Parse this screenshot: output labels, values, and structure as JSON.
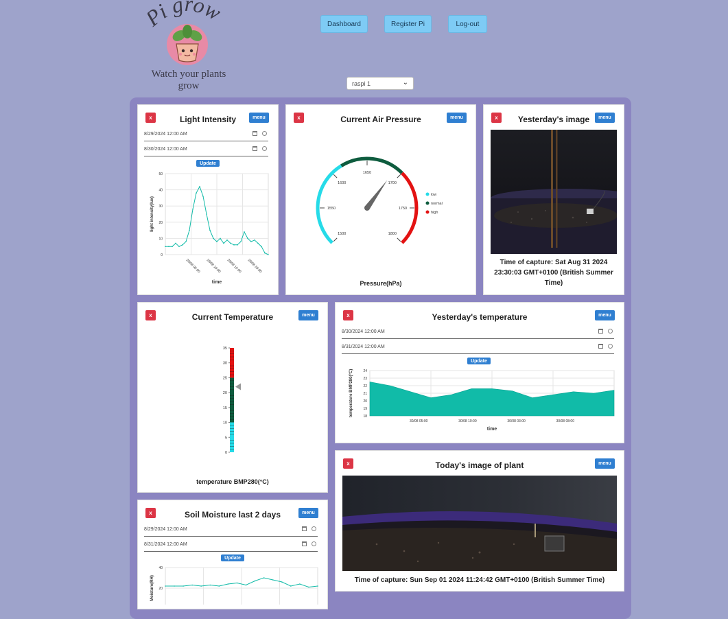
{
  "header": {
    "logo_text": "Pi grow",
    "tagline": "Watch your plants grow",
    "nav": [
      "Dashboard",
      "Register Pi",
      "Log-out"
    ],
    "device_select": "raspi 1"
  },
  "common": {
    "close": "x",
    "menu": "menu",
    "update": "Update"
  },
  "light": {
    "title": "Light Intensity",
    "start": "8/29/2024 12:00 AM",
    "end": "8/30/2024 12:00 AM",
    "chart_data": {
      "type": "line",
      "title": "",
      "xlabel": "time",
      "ylabel": "light intensity(lux)",
      "ylim": [
        0,
        50
      ],
      "yticks": [
        "0",
        "10",
        "20",
        "30",
        "40",
        "50"
      ],
      "xticks": [
        "29/08 05:00",
        "29/08 10:00",
        "29/08 15:00",
        "29/08 20:00"
      ],
      "x": [
        "00:00",
        "02:00",
        "03:00",
        "04:00",
        "05:00",
        "05:30",
        "06:00",
        "06:30",
        "06:45",
        "07:00",
        "07:15",
        "07:30",
        "07:45",
        "08:00",
        "08:30",
        "09:00",
        "09:30",
        "10:00",
        "10:30",
        "11:00",
        "12:00",
        "13:00",
        "14:00",
        "14:30",
        "15:00",
        "15:30",
        "16:00",
        "17:00",
        "18:00",
        "19:00",
        "20:00"
      ],
      "values": [
        5,
        5,
        5,
        7,
        5,
        6,
        8,
        15,
        28,
        38,
        42,
        36,
        25,
        15,
        10,
        8,
        10,
        7,
        9,
        7,
        6,
        6,
        8,
        14,
        10,
        8,
        9,
        7,
        5,
        1,
        0
      ]
    }
  },
  "pressure": {
    "title": "Current Air Pressure",
    "label": "Pressure(hPa)",
    "ticks": [
      "1500",
      "1550",
      "1600",
      "1650",
      "1700",
      "1750",
      "1800"
    ],
    "legend": [
      "low",
      "normal",
      "high"
    ],
    "value": 1690,
    "colors": {
      "low": "#26dbe8",
      "normal": "#0e5c3e",
      "high": "#e31212"
    }
  },
  "yest_image": {
    "title": "Yesterday's image",
    "caption": "Time of capture: Sat Aug 31 2024 23:30:03 GMT+0100 (British Summer Time)"
  },
  "temp": {
    "title": "Current Temperature",
    "label": "temperature BMP280(°C)",
    "ticks": [
      "0",
      "5",
      "10",
      "15",
      "20",
      "25",
      "30",
      "35"
    ],
    "value": 22
  },
  "yest_temp": {
    "title": "Yesterday's temperature",
    "start": "8/30/2024 12:00 AM",
    "end": "8/31/2024 12:00 AM",
    "chart_data": {
      "type": "area",
      "title": "",
      "xlabel": "time",
      "ylabel": "temperature BMP280(°C)",
      "ylim": [
        18,
        24
      ],
      "yticks": [
        "18",
        "19",
        "20",
        "21",
        "22",
        "23",
        "24"
      ],
      "xticks": [
        "30/08 05:00",
        "30/08 10:00",
        "30/08 03:00",
        "30/08 08:00"
      ],
      "x": [
        "00:00",
        "02:00",
        "04:00",
        "06:00",
        "08:00",
        "10:00",
        "12:00",
        "14:00",
        "16:00",
        "18:00",
        "20:00",
        "22:00",
        "24:00"
      ],
      "values": [
        22.5,
        22.0,
        21.2,
        20.4,
        20.8,
        21.6,
        21.6,
        21.3,
        20.4,
        20.8,
        21.2,
        21.0,
        21.4
      ]
    }
  },
  "today_image": {
    "title": "Today's image of plant",
    "caption": "Time of capture: Sun Sep 01 2024 11:24:42 GMT+0100 (British Summer Time)"
  },
  "soil": {
    "title": "Soil Moisture last 2 days",
    "start": "8/29/2024 12:00 AM",
    "end": "8/31/2024 12:00 AM",
    "chart_data": {
      "type": "line",
      "title": "",
      "xlabel": "",
      "ylabel": "Moisture(RH)",
      "ylim": [
        0,
        40
      ],
      "yticks": [
        "20",
        "40"
      ],
      "x": [],
      "values": [
        22,
        22,
        22,
        23,
        22,
        23,
        22,
        24,
        25,
        23,
        27,
        30,
        28,
        26,
        22,
        24,
        21,
        22
      ]
    }
  }
}
